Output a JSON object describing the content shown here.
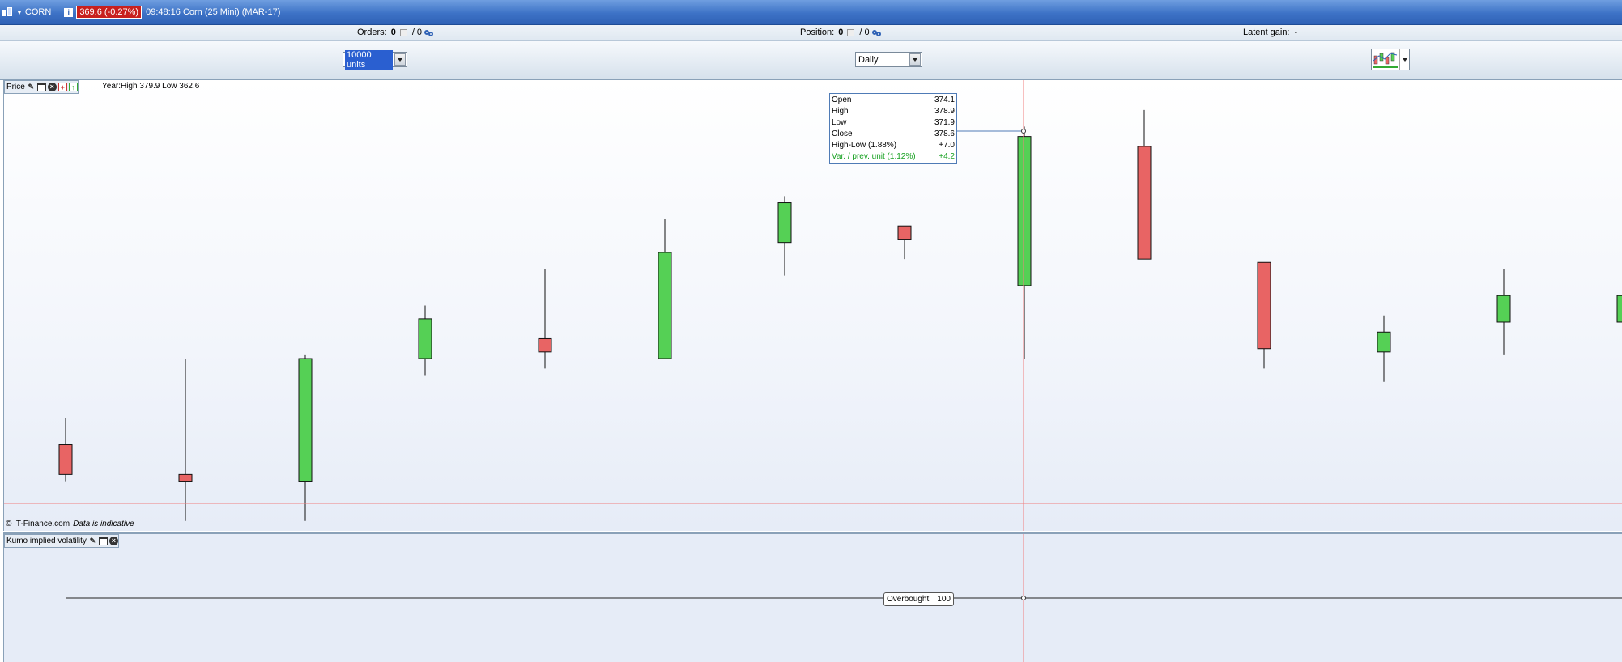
{
  "titlebar": {
    "symbol": "CORN",
    "price_badge": "369.6 (-0.27%)",
    "description": "09:48:16 Corn (25 Mini) (MAR-17)",
    "info_icon": "i"
  },
  "inforow": {
    "orders_label": "Orders:",
    "orders_value": "0",
    "orders_sep": "/ 0",
    "position_label": "Position:",
    "position_value": "0",
    "position_sep": "/ 0",
    "latent_label": "Latent gain:",
    "latent_value": "-"
  },
  "controls": {
    "units_value": "10000 units",
    "period_value": "Daily",
    "chart_type_icon": "candlestick-chart-icon"
  },
  "price_panel": {
    "title": "Price",
    "year_range": "Year:High 379.9 Low 362.6",
    "watermark": "© IT-Finance.com",
    "watermark_note": "Data is indicative"
  },
  "tooltip": {
    "rows": [
      {
        "label": "Open",
        "value": "374.1"
      },
      {
        "label": "High",
        "value": "378.9"
      },
      {
        "label": "Low",
        "value": "371.9"
      },
      {
        "label": "Close",
        "value": "378.6"
      },
      {
        "label": "High-Low (1.88%)",
        "value": "+7.0"
      },
      {
        "label": "Var. / prev. unit (1.12%)",
        "value": "+4.2"
      }
    ]
  },
  "vol_panel": {
    "title": "Kumo implied volatility",
    "overbought_label": "Overbought",
    "overbought_value": "100"
  },
  "colors": {
    "up": "#55d055",
    "down": "#e86464",
    "crosshair": "#f08080"
  },
  "chart_data": {
    "type": "candlestick",
    "series": [
      {
        "name": "Price",
        "candles": [
          {
            "o": 369.3,
            "h": 370.1,
            "l": 368.2,
            "c": 368.4
          },
          {
            "o": 368.4,
            "h": 371.9,
            "l": 367.0,
            "c": 368.2
          },
          {
            "o": 368.2,
            "h": 372.0,
            "l": 367.0,
            "c": 371.9
          },
          {
            "o": 371.9,
            "h": 373.5,
            "l": 371.4,
            "c": 373.1
          },
          {
            "o": 372.5,
            "h": 374.6,
            "l": 371.6,
            "c": 372.1
          },
          {
            "o": 371.9,
            "h": 376.1,
            "l": 371.9,
            "c": 375.1
          },
          {
            "o": 375.4,
            "h": 376.8,
            "l": 374.4,
            "c": 376.6
          },
          {
            "o": 375.9,
            "h": 375.9,
            "l": 374.9,
            "c": 375.5
          },
          {
            "o": 374.1,
            "h": 378.9,
            "l": 371.9,
            "c": 378.6
          },
          {
            "o": 378.3,
            "h": 379.4,
            "l": 374.9,
            "c": 374.9
          },
          {
            "o": 374.8,
            "h": 374.8,
            "l": 371.6,
            "c": 372.2
          },
          {
            "o": 372.1,
            "h": 373.2,
            "l": 371.2,
            "c": 372.7
          },
          {
            "o": 373.0,
            "h": 374.6,
            "l": 372.0,
            "c": 373.8
          },
          {
            "o": 373.0,
            "h": 373.6,
            "l": 371.0,
            "c": 373.8
          }
        ]
      }
    ],
    "yrange": [
      366.7,
      380.3
    ]
  }
}
